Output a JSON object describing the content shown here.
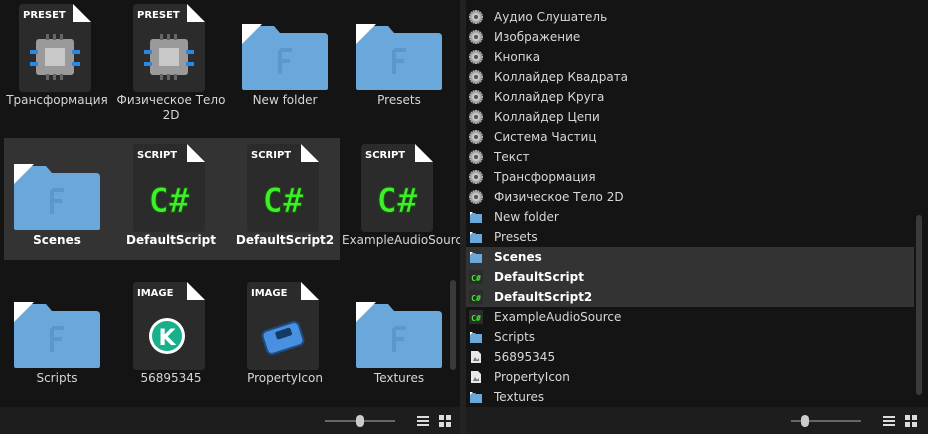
{
  "left_grid": {
    "items": [
      {
        "label": "Трансформация",
        "type": "preset",
        "badge": "PRESET"
      },
      {
        "label": "Физическое Тело 2D",
        "type": "preset",
        "badge": "PRESET"
      },
      {
        "label": "New folder",
        "type": "folder"
      },
      {
        "label": "Presets",
        "type": "folder"
      },
      {
        "label": "Scenes",
        "type": "folder",
        "selected": true
      },
      {
        "label": "DefaultScript",
        "type": "script",
        "badge": "SCRIPT",
        "selected": true
      },
      {
        "label": "DefaultScript2",
        "type": "script",
        "badge": "SCRIPT",
        "selected": true
      },
      {
        "label": "ExampleAudioSource",
        "type": "script",
        "badge": "SCRIPT"
      },
      {
        "label": "Scripts",
        "type": "folder"
      },
      {
        "label": "56895345",
        "type": "image-k",
        "badge": "IMAGE"
      },
      {
        "label": "PropertyIcon",
        "type": "image-prop",
        "badge": "IMAGE"
      },
      {
        "label": "Textures",
        "type": "folder"
      }
    ]
  },
  "right_list": {
    "items": [
      {
        "label": "Аудио Слушатель",
        "icon": "gear-icon"
      },
      {
        "label": "Изображение",
        "icon": "gear-icon"
      },
      {
        "label": "Кнопка",
        "icon": "gear-icon"
      },
      {
        "label": "Коллайдер Квадрата",
        "icon": "gear-icon"
      },
      {
        "label": "Коллайдер Круга",
        "icon": "gear-icon"
      },
      {
        "label": "Коллайдер Цепи",
        "icon": "gear-icon"
      },
      {
        "label": "Система Частиц",
        "icon": "gear-icon"
      },
      {
        "label": "Текст",
        "icon": "gear-icon"
      },
      {
        "label": "Трансформация",
        "icon": "gear-icon"
      },
      {
        "label": "Физическое Тело 2D",
        "icon": "gear-icon"
      },
      {
        "label": "New folder",
        "icon": "folder-icon"
      },
      {
        "label": "Presets",
        "icon": "folder-icon"
      },
      {
        "label": "Scenes",
        "icon": "folder-icon",
        "selected": true
      },
      {
        "label": "DefaultScript",
        "icon": "csharp-icon",
        "selected": true
      },
      {
        "label": "DefaultScript2",
        "icon": "csharp-icon",
        "selected": true
      },
      {
        "label": "ExampleAudioSource",
        "icon": "csharp-icon"
      },
      {
        "label": "Scripts",
        "icon": "folder-icon"
      },
      {
        "label": "56895345",
        "icon": "image-icon"
      },
      {
        "label": "PropertyIcon",
        "icon": "image-icon"
      },
      {
        "label": "Textures",
        "icon": "folder-icon"
      }
    ]
  },
  "colors": {
    "folder": "#6aa8dc",
    "csharp": "#3ef02a",
    "doc": "#2b2b2b"
  },
  "csharp_glyph": "C#",
  "k_glyph": "K",
  "left_bar": {
    "zoom": 0.5
  },
  "right_bar": {
    "zoom": 0.2
  }
}
